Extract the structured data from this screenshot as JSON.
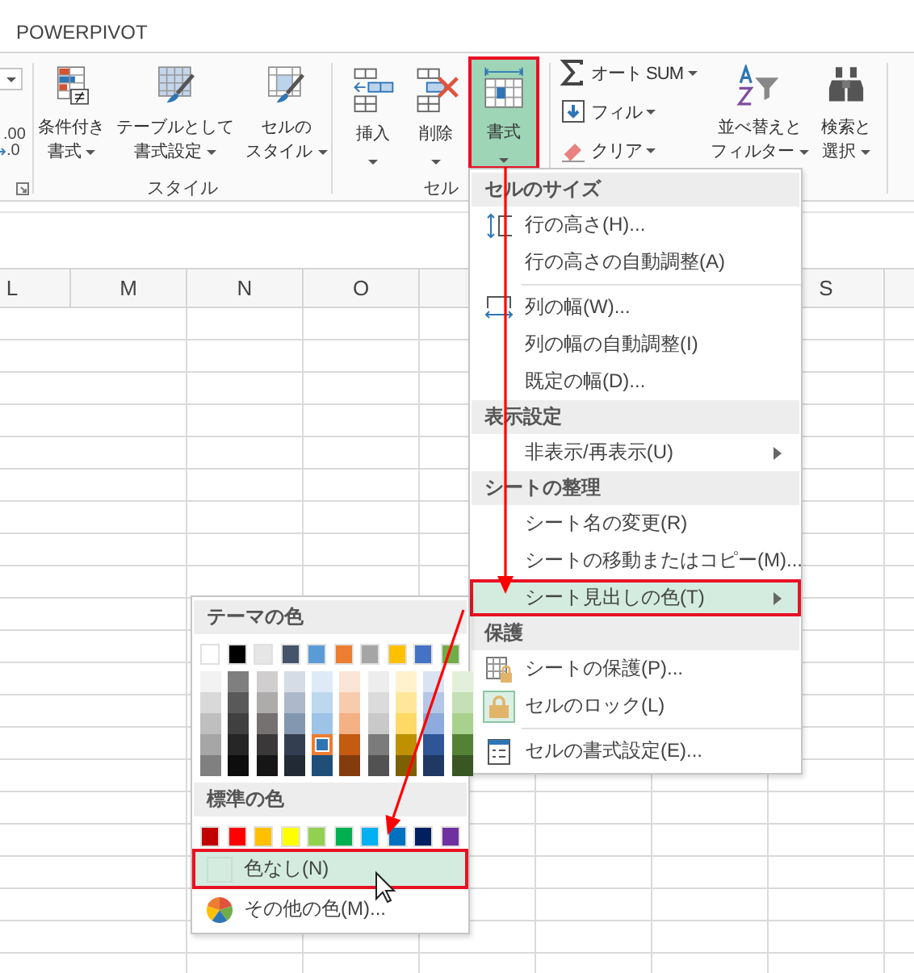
{
  "ribbon_tab": "POWERPIVOT",
  "ribbon": {
    "left_partial": {
      "texts": [
        ".00",
        ".0"
      ]
    },
    "groups": [
      {
        "label": "スタイル",
        "buttons": [
          {
            "kind": "conditional",
            "lines": [
              "条件付き",
              "書式"
            ],
            "selected": false
          },
          {
            "kind": "table",
            "lines": [
              "テーブルとして",
              "書式設定"
            ],
            "selected": false
          },
          {
            "kind": "cellstyle",
            "lines": [
              "セルの",
              "スタイル"
            ],
            "selected": false
          }
        ]
      },
      {
        "label": "セル",
        "buttons": [
          {
            "kind": "insert",
            "lines": [
              "挿入"
            ],
            "selected": false
          },
          {
            "kind": "delete",
            "lines": [
              "削除"
            ],
            "selected": false
          },
          {
            "kind": "format",
            "lines": [
              "書式"
            ],
            "selected": true
          }
        ]
      },
      {
        "small_buttons": [
          {
            "kind": "sum",
            "label": "オート SUM"
          },
          {
            "kind": "fill",
            "label": "フィル"
          },
          {
            "kind": "clear",
            "label": "クリア"
          }
        ],
        "buttons": [
          {
            "kind": "sort",
            "lines": [
              "並べ替えと",
              "フィルター"
            ],
            "selected": false
          },
          {
            "kind": "find",
            "lines": [
              "検索と",
              "選択"
            ],
            "selected": false
          }
        ]
      }
    ]
  },
  "columns": [
    "L",
    "M",
    "N",
    "O",
    "",
    "",
    "",
    "S",
    ""
  ],
  "format_menu": [
    {
      "kind": "header",
      "label": "セルのサイズ"
    },
    {
      "kind": "rowheight",
      "label": "行の高さ(H)...",
      "selected": false
    },
    {
      "kind": "plain",
      "label": "行の高さの自動調整(A)",
      "selected": false
    },
    {
      "kind": "separator"
    },
    {
      "kind": "colwidth",
      "label": "列の幅(W)...",
      "selected": false
    },
    {
      "kind": "plain",
      "label": "列の幅の自動調整(I)",
      "selected": false
    },
    {
      "kind": "plain",
      "label": "既定の幅(D)...",
      "selected": false
    },
    {
      "kind": "header",
      "label": "表示設定"
    },
    {
      "kind": "submenu",
      "label": "非表示/再表示(U)",
      "selected": false
    },
    {
      "kind": "header",
      "label": "シートの整理"
    },
    {
      "kind": "plain",
      "label": "シート名の変更(R)",
      "selected": false
    },
    {
      "kind": "plain",
      "label": "シートの移動またはコピー(M)...",
      "selected": false
    },
    {
      "kind": "submenu",
      "label": "シート見出しの色(T)",
      "selected": true
    },
    {
      "kind": "header",
      "label": "保護"
    },
    {
      "kind": "protect",
      "label": "シートの保護(P)...",
      "selected": false
    },
    {
      "kind": "lock",
      "label": "セルのロック(L)",
      "selected": false,
      "checked": true
    },
    {
      "kind": "separator"
    },
    {
      "kind": "formatcells",
      "label": "セルの書式設定(E)...",
      "selected": false
    }
  ],
  "color_menu": {
    "theme_header": "テーマの色",
    "theme_colors": [
      {
        "color": "#ffffff",
        "selected": false,
        "shades": [
          {
            "color": "#f2f2f2",
            "selected": false
          },
          {
            "color": "#d9d9d9",
            "selected": false
          },
          {
            "color": "#bfbfbf",
            "selected": false
          },
          {
            "color": "#a6a6a6",
            "selected": false
          },
          {
            "color": "#808080",
            "selected": false
          }
        ]
      },
      {
        "color": "#000000",
        "selected": false,
        "shades": [
          {
            "color": "#7f7f7f",
            "selected": false
          },
          {
            "color": "#595959",
            "selected": false
          },
          {
            "color": "#404040",
            "selected": false
          },
          {
            "color": "#262626",
            "selected": false
          },
          {
            "color": "#0d0d0d",
            "selected": false
          }
        ]
      },
      {
        "color": "#e7e6e6",
        "selected": false,
        "shades": [
          {
            "color": "#d0cece",
            "selected": false
          },
          {
            "color": "#aeabab",
            "selected": false
          },
          {
            "color": "#757171",
            "selected": false
          },
          {
            "color": "#3a3838",
            "selected": false
          },
          {
            "color": "#171616",
            "selected": false
          }
        ]
      },
      {
        "color": "#44546a",
        "selected": false,
        "shades": [
          {
            "color": "#d6dce5",
            "selected": false
          },
          {
            "color": "#adb9ca",
            "selected": false
          },
          {
            "color": "#8497b0",
            "selected": false
          },
          {
            "color": "#333f50",
            "selected": false
          },
          {
            "color": "#222a35",
            "selected": false
          }
        ]
      },
      {
        "color": "#5b9bd5",
        "selected": false,
        "shades": [
          {
            "color": "#deebf7",
            "selected": false
          },
          {
            "color": "#bdd7ee",
            "selected": false
          },
          {
            "color": "#9dc3e6",
            "selected": false
          },
          {
            "color": "#2e75b6",
            "selected": true
          },
          {
            "color": "#1f4e79",
            "selected": false
          }
        ]
      },
      {
        "color": "#ed7d31",
        "selected": false,
        "shades": [
          {
            "color": "#fbe5d6",
            "selected": false
          },
          {
            "color": "#f8cbad",
            "selected": false
          },
          {
            "color": "#f4b183",
            "selected": false
          },
          {
            "color": "#c55a11",
            "selected": false
          },
          {
            "color": "#843c0c",
            "selected": false
          }
        ]
      },
      {
        "color": "#a5a5a5",
        "selected": false,
        "shades": [
          {
            "color": "#ededed",
            "selected": false
          },
          {
            "color": "#dbdbdb",
            "selected": false
          },
          {
            "color": "#c9c9c9",
            "selected": false
          },
          {
            "color": "#7b7b7b",
            "selected": false
          },
          {
            "color": "#525252",
            "selected": false
          }
        ]
      },
      {
        "color": "#ffc000",
        "selected": false,
        "shades": [
          {
            "color": "#fff2cc",
            "selected": false
          },
          {
            "color": "#ffe699",
            "selected": false
          },
          {
            "color": "#ffd966",
            "selected": false
          },
          {
            "color": "#bf9000",
            "selected": false
          },
          {
            "color": "#7f6000",
            "selected": false
          }
        ]
      },
      {
        "color": "#4472c4",
        "selected": false,
        "shades": [
          {
            "color": "#dae3f3",
            "selected": false
          },
          {
            "color": "#b4c7e7",
            "selected": false
          },
          {
            "color": "#8faadc",
            "selected": false
          },
          {
            "color": "#2f5597",
            "selected": false
          },
          {
            "color": "#203864",
            "selected": false
          }
        ]
      },
      {
        "color": "#70ad47",
        "selected": false,
        "shades": [
          {
            "color": "#e2f0d9",
            "selected": false
          },
          {
            "color": "#c5e0b4",
            "selected": false
          },
          {
            "color": "#a9d18e",
            "selected": false
          },
          {
            "color": "#548235",
            "selected": false
          },
          {
            "color": "#385723",
            "selected": false
          }
        ]
      }
    ],
    "standard_header": "標準の色",
    "standard_colors": [
      {
        "color": "#c00000",
        "selected": false
      },
      {
        "color": "#ff0000",
        "selected": false
      },
      {
        "color": "#ffc000",
        "selected": false
      },
      {
        "color": "#ffff00",
        "selected": false
      },
      {
        "color": "#92d050",
        "selected": false
      },
      {
        "color": "#00b050",
        "selected": false
      },
      {
        "color": "#00b0f0",
        "selected": false
      },
      {
        "color": "#0070c0",
        "selected": false
      },
      {
        "color": "#002060",
        "selected": false
      },
      {
        "color": "#7030a0",
        "selected": false
      }
    ],
    "actions": [
      {
        "kind": "nocolor",
        "label": "色なし(N)",
        "selected": true
      },
      {
        "kind": "more",
        "label": "その他の色(M)...",
        "selected": false
      }
    ]
  }
}
